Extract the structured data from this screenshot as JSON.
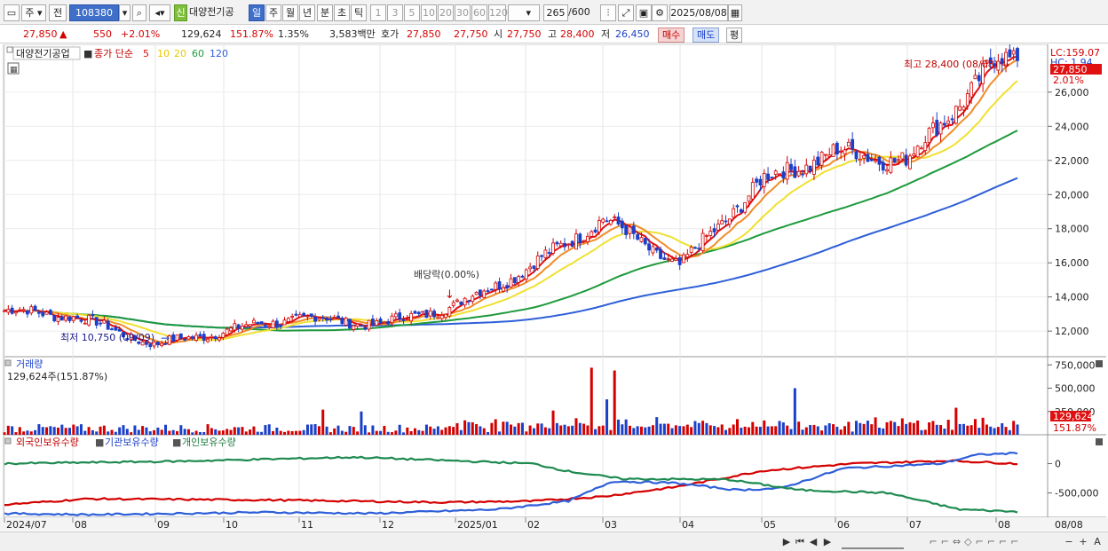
{
  "toolbar": {
    "period_label": "주",
    "prev_label": "전",
    "code_value": "108380",
    "badge_label": "신",
    "stock_name": "대양전기공",
    "tabs": [
      "일",
      "주",
      "월",
      "년",
      "분",
      "초",
      "틱"
    ],
    "active_tab": "일",
    "intervals": [
      "1",
      "3",
      "5",
      "10",
      "20",
      "30",
      "60",
      "120"
    ],
    "count_value": "265",
    "count_total": "/600",
    "date_value": "2025/08/08"
  },
  "info": {
    "price": "27,850",
    "change": "550",
    "change_pct": "+2.01%",
    "volume": "129,624",
    "volume_ratio": "151.87%",
    "turnover": "1.35%",
    "amount": "3,583백만",
    "bid_label": "호가",
    "ask_price": "27,850",
    "bid_price": "27,750",
    "open_label": "시",
    "open": "27,750",
    "high_label": "고",
    "high": "28,400",
    "low_label": "저",
    "low": "26,450",
    "buy_label": "매수",
    "sell_label": "매도",
    "eval_label": "평"
  },
  "colors": {
    "up": "#d40000",
    "down": "#1a3fc8",
    "ma5": "#e01010",
    "ma10": "#f08c28",
    "ma20": "#f0e030",
    "ma60": "#1e9a3c",
    "ma120": "#2e5fd8",
    "foreign": "#d40000",
    "institution": "#2e5fd8",
    "individual": "#1e8a50"
  },
  "price_panel": {
    "legend_stock": "대양전기공업",
    "legend_type": "종가 단순",
    "ma_labels": [
      "5",
      "10",
      "20",
      "60",
      "120"
    ],
    "lc_label": "LC:159.07",
    "hc_label": "HC: 1.94",
    "last_price_tag": "27,850",
    "last_pct": "2.01%",
    "y_ticks": [
      "26,000",
      "24,000",
      "22,000",
      "20,000",
      "18,000",
      "16,000",
      "14,000",
      "12,000"
    ],
    "high_annotation": "최고 28,400 (08/08)",
    "low_annotation": "최저 10,750 (09/09)",
    "event_annotation": "배당락(0.00%)"
  },
  "volume_panel": {
    "title": "거래량",
    "value_label": "129,624주(151.87%)",
    "y_ticks": [
      "750,000",
      "500,000",
      "250,000"
    ],
    "last_tag": "129,624",
    "pct_tag": "151.87%"
  },
  "holding_panel": {
    "series": [
      "외국인보유수량",
      "기관보유수량",
      "개인보유수량"
    ],
    "y_ticks": [
      "0",
      "-500,000"
    ]
  },
  "x_axis": {
    "labels": [
      "2024/07",
      "08",
      "09",
      "10",
      "11",
      "12",
      "2025/01",
      "02",
      "03",
      "04",
      "05",
      "06",
      "07",
      "08"
    ],
    "right_label": "08/08"
  },
  "chart_data": {
    "type": "candlestick",
    "x_range": [
      "2024/07",
      "2025/08/08"
    ],
    "price_ylim": [
      10500,
      28800
    ],
    "price_anchors": [
      {
        "month": "2024/07",
        "close": 13200
      },
      {
        "month": "08",
        "close": 12900
      },
      {
        "month": "09",
        "close": 11200
      },
      {
        "month": "10",
        "close": 12000
      },
      {
        "month": "11",
        "close": 12800
      },
      {
        "month": "12",
        "close": 12400
      },
      {
        "month": "2025/01",
        "close": 13500
      },
      {
        "month": "02",
        "close": 15600
      },
      {
        "month": "03",
        "close": 18600
      },
      {
        "month": "04",
        "close": 15800
      },
      {
        "month": "05",
        "close": 20800
      },
      {
        "month": "06",
        "close": 22500
      },
      {
        "month": "07",
        "close": 22000
      },
      {
        "month": "08",
        "close": 27850
      }
    ],
    "high": {
      "value": 28400,
      "date": "08/08"
    },
    "low": {
      "value": 10750,
      "date": "09/09"
    },
    "volume_ylim": [
      0,
      800000
    ],
    "volume_spikes": [
      {
        "month": "03",
        "value": 720000
      },
      {
        "month": "03",
        "value": 690000
      },
      {
        "month": "05",
        "value": 500000
      }
    ],
    "holding_ylim": [
      -900000,
      250000
    ]
  },
  "bottom": {
    "nav_buttons": [
      "▶",
      "⏮",
      "◀",
      "▶"
    ],
    "tools": [
      "−",
      "+",
      "A"
    ]
  }
}
